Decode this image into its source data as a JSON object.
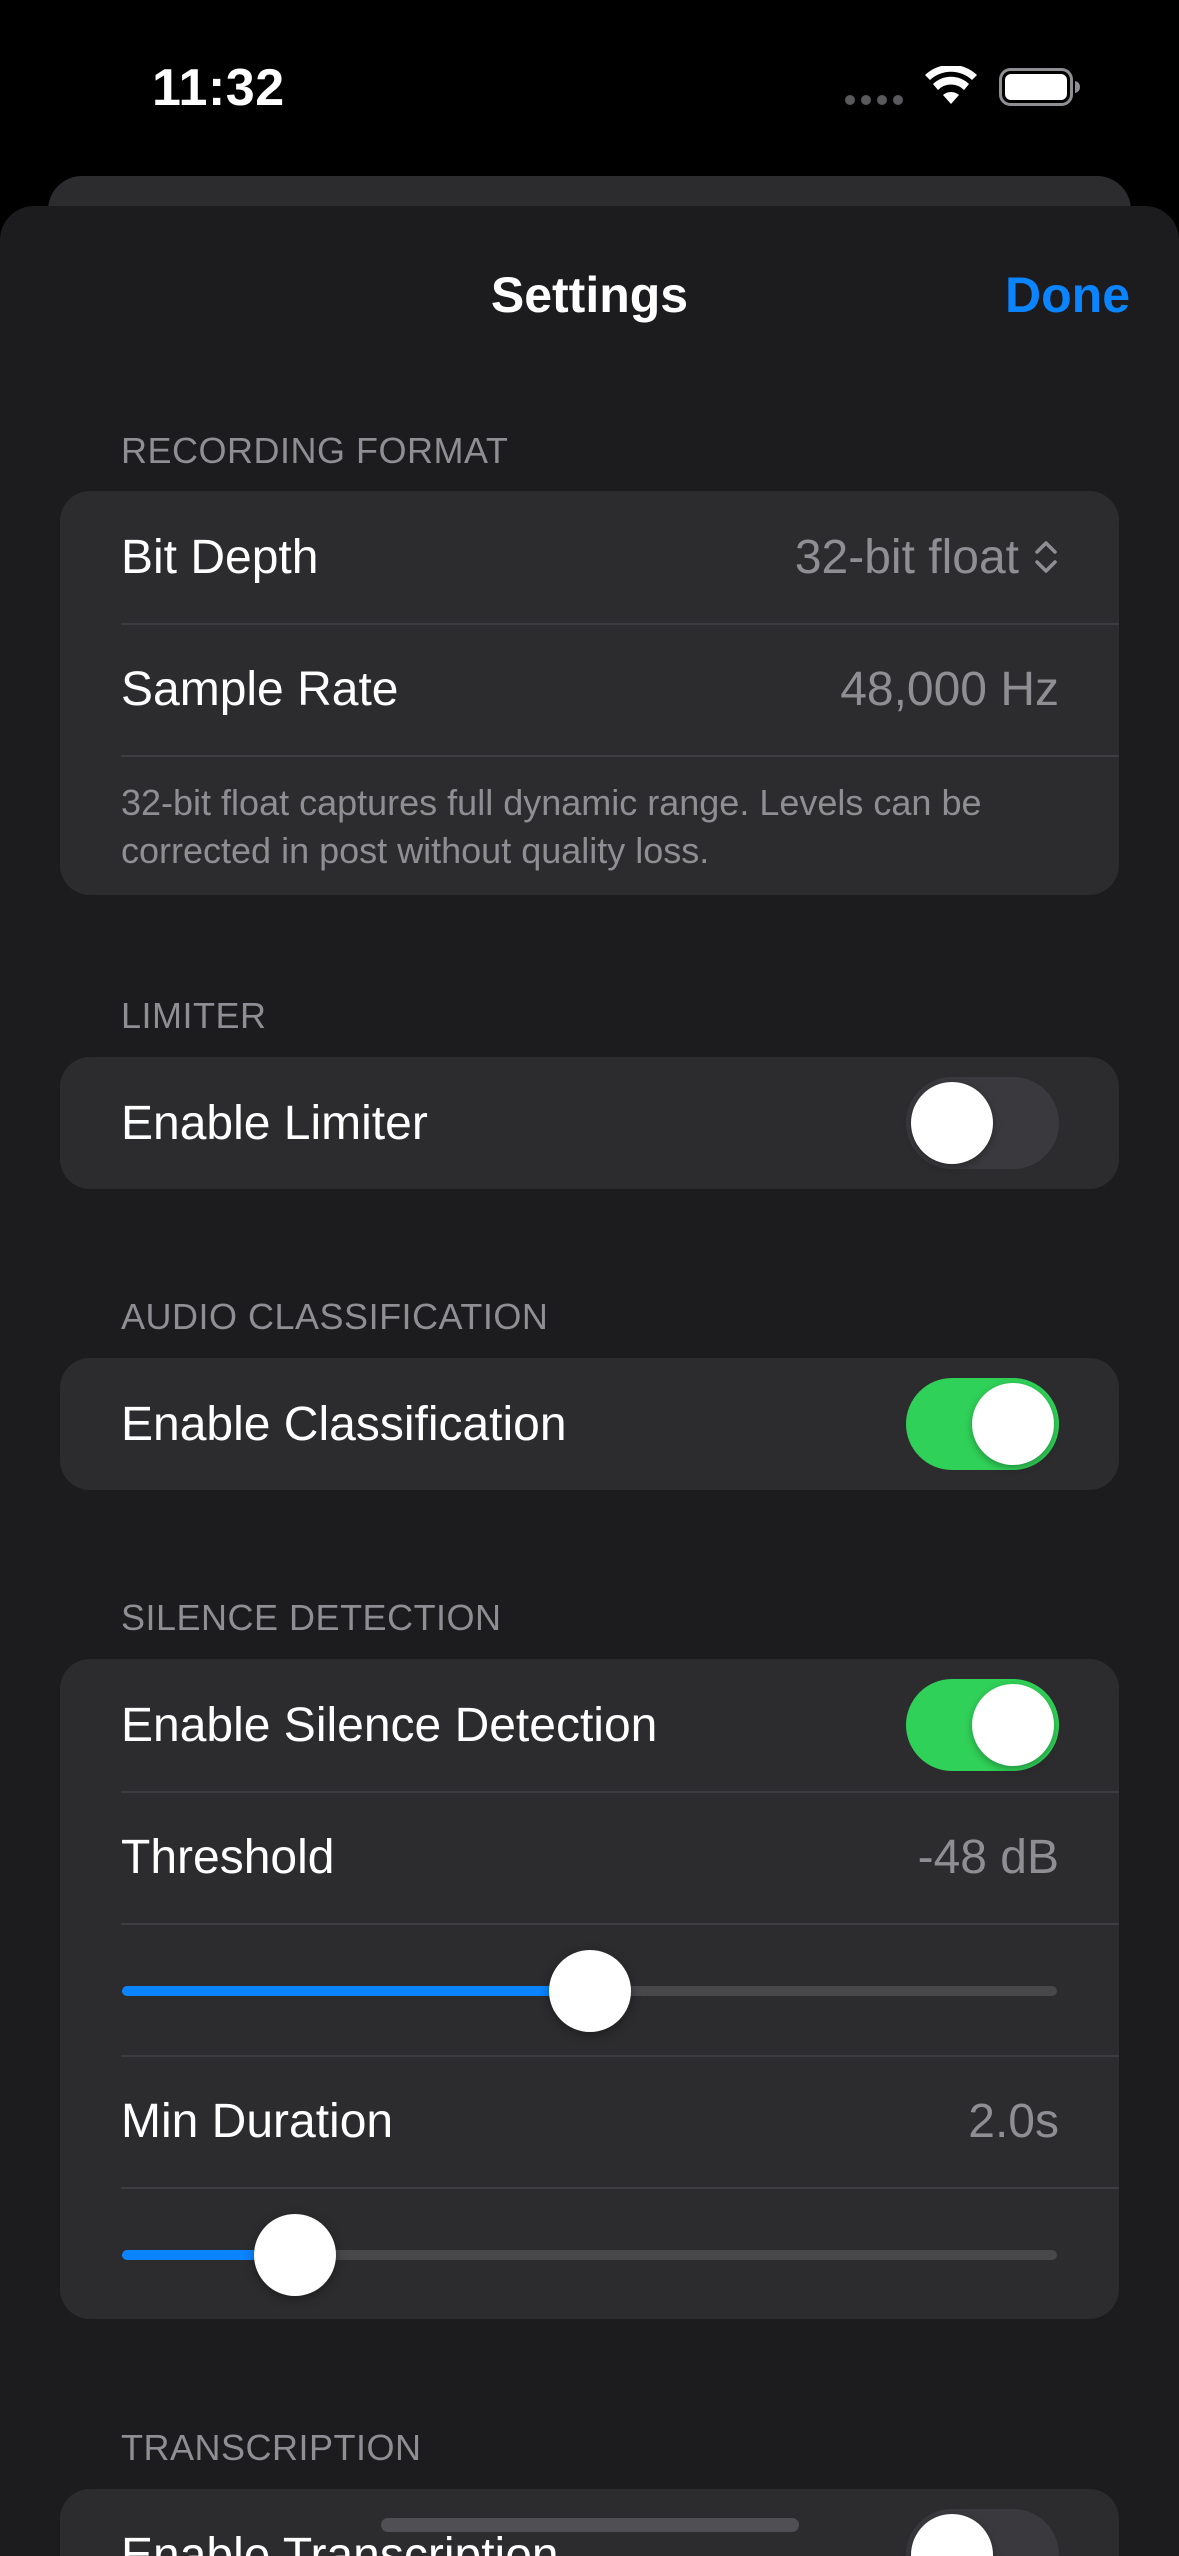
{
  "status_bar": {
    "time": "11:32",
    "icons": [
      "cellular-dots-icon",
      "wifi-icon",
      "battery-icon"
    ]
  },
  "nav": {
    "title": "Settings",
    "done_label": "Done"
  },
  "colors": {
    "accent": "#0a84ff",
    "toggle_on": "#30d158",
    "toggle_off": "#3a3a3e",
    "sheet_bg": "#1c1c1e",
    "group_bg": "#2c2c2e",
    "secondary_text": "#8e8e93"
  },
  "recording_format": {
    "header": "Recording Format",
    "bit_depth_label": "Bit Depth",
    "bit_depth_value": "32-bit float",
    "sample_rate_label": "Sample Rate",
    "sample_rate_value": "48,000 Hz",
    "footnote": "32-bit float captures full dynamic range. Levels can be corrected in post without quality loss."
  },
  "limiter": {
    "header": "Limiter",
    "enable_label": "Enable Limiter",
    "enabled": false
  },
  "audio_classification": {
    "header": "Audio Classification",
    "enable_label": "Enable Classification",
    "enabled": true
  },
  "silence_detection": {
    "header": "Silence Detection",
    "enable_label": "Enable Silence Detection",
    "enabled": true,
    "threshold_label": "Threshold",
    "threshold_value": "-48 dB",
    "threshold_slider_fraction": 0.5,
    "min_duration_label": "Min Duration",
    "min_duration_value": "2.0s",
    "min_duration_slider_fraction": 0.185
  },
  "transcription": {
    "header": "Transcription",
    "enable_label": "Enable Transcription",
    "enabled": false
  }
}
